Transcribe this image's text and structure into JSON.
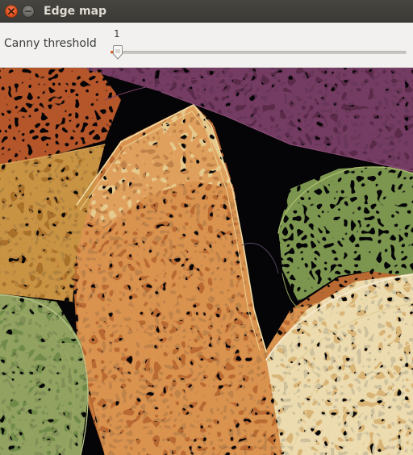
{
  "window": {
    "title": "Edge map"
  },
  "trackbar": {
    "label": "Canny threshold",
    "value": "1",
    "value_fraction": 0.01
  },
  "image": {
    "description_icon": "edge-map-image",
    "palette": {
      "orange_edges": "#d9803c",
      "cream_edges": "#e8d7a6",
      "green_edges": "#8ea25a",
      "purple_edges": "#6a3a5a",
      "background": "#050406"
    }
  },
  "colors": {
    "accent": "#e05a1c",
    "titlebar": "#3c3b37"
  }
}
